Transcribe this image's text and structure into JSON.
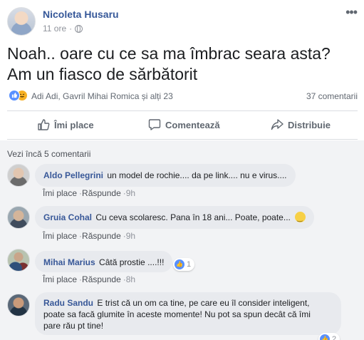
{
  "post": {
    "author": "Nicoleta Husaru",
    "time": "11 ore",
    "dot": "·",
    "text_line1": "Noah.. oare cu ce sa ma îmbrac seara asta?",
    "text_line2": "Am un fiasco de sărbătorit",
    "more_glyph": "•••"
  },
  "reactions": {
    "names": "Adi Adi, Gavril Mihai Romica și alți 23",
    "comments_count": "37 comentarii",
    "icons": [
      "like-icon",
      "haha-icon"
    ]
  },
  "actions": {
    "like": "Îmi place",
    "comment": "Comentează",
    "share": "Distribuie"
  },
  "comments_section": {
    "view_more": "Vezi încă 5 comentarii",
    "like_label": "Îmi place",
    "reply_label": "Răspunde",
    "sep": "·",
    "items": [
      {
        "name": "Aldo Pellegrini",
        "text": "un model de rochie.... da pe link.... nu e virus....",
        "time": "9h"
      },
      {
        "name": "Gruia Cohal",
        "text": "Cu ceva scolaresc. Pana în 18 ani... Poate, poate...",
        "time": "9h",
        "emoji": "smiley-icon"
      },
      {
        "name": "Mihai Marius",
        "text": "Câtă prostie ....!!!",
        "time": "8h",
        "likes": "1"
      },
      {
        "name": "Radu Sandu",
        "text_line1": "E trist că un om ca tine, pe care eu îl consider inteligent,",
        "text_line2": "poate sa facă glumite în aceste momente! Nu pot sa spun decât că îmi",
        "text_line3": "pare rău pt tine!",
        "likes": "2"
      }
    ]
  },
  "colors": {
    "link_blue": "#385898",
    "meta_gray": "#90949c",
    "bubble_bg": "#e8eaee",
    "like_blue": "#5890ff"
  }
}
